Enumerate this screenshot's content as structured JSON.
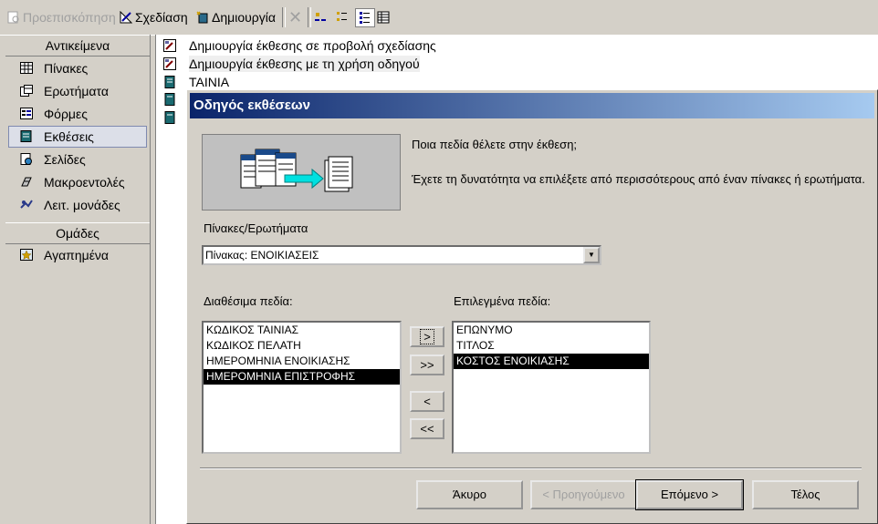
{
  "toolbar": {
    "preview": "Προεπισκόπηση",
    "design": "Σχεδίαση",
    "create": "Δημιουργία"
  },
  "left_panel": {
    "objects_header": "Αντικείμενα",
    "items": [
      {
        "label": "Πίνακες",
        "icon": "table-icon"
      },
      {
        "label": "Ερωτήματα",
        "icon": "query-icon"
      },
      {
        "label": "Φόρμες",
        "icon": "form-icon"
      },
      {
        "label": "Εκθέσεις",
        "icon": "report-icon",
        "selected": true
      },
      {
        "label": "Σελίδες",
        "icon": "page-icon"
      },
      {
        "label": "Μακροεντολές",
        "icon": "macro-icon"
      },
      {
        "label": "Λειτ. μονάδες",
        "icon": "module-icon"
      }
    ],
    "groups_header": "Ομάδες",
    "favorites": "Αγαπημένα"
  },
  "right_list": [
    {
      "label": "Δημιουργία έκθεσης σε προβολή σχεδίασης",
      "icon": "wizard-icon"
    },
    {
      "label": "Δημιουργία έκθεσης με τη χρήση οδηγού",
      "icon": "wizard-icon"
    },
    {
      "label": "ΤΑΙΝΙΑ",
      "icon": "report-icon"
    }
  ],
  "dialog": {
    "title": "Οδηγός εκθέσεων",
    "question": "Ποια πεδία θέλετε στην έκθεση;",
    "hint": "Έχετε τη δυνατότητα να επιλέξετε από περισσότερους από έναν πίνακες ή ερωτήματα.",
    "tables_label": "Πίνακες/Ερωτήματα",
    "tables_value": "Πίνακας: ΕΝΟΙΚΙΑΣΕΙΣ",
    "available_label": "Διαθέσιμα πεδία:",
    "selected_label": "Επιλεγμένα πεδία:",
    "available_fields": [
      "ΚΩΔΙΚΟΣ ΤΑΙΝΙΑΣ",
      "ΚΩΔΙΚΟΣ ΠΕΛΑΤΗ",
      "ΗΜΕΡΟΜΗΝΙΑ ΕΝΟΙΚΙΑΣΗΣ",
      "ΗΜΕΡΟΜΗΝΙΑ ΕΠΙΣΤΡΟΦΗΣ"
    ],
    "selected_fields": [
      "ΕΠΩΝΥΜΟ",
      "ΤΙΤΛΟΣ",
      "ΚΟΣΤΟΣ ΕΝΟΙΚΙΑΣΗΣ"
    ],
    "move_one": ">",
    "move_all": ">>",
    "remove_one": "<",
    "remove_all": "<<",
    "cancel": "Άκυρο",
    "back": "< Προηγούμενο",
    "next": "Επόμενο >",
    "finish": "Τέλος"
  }
}
